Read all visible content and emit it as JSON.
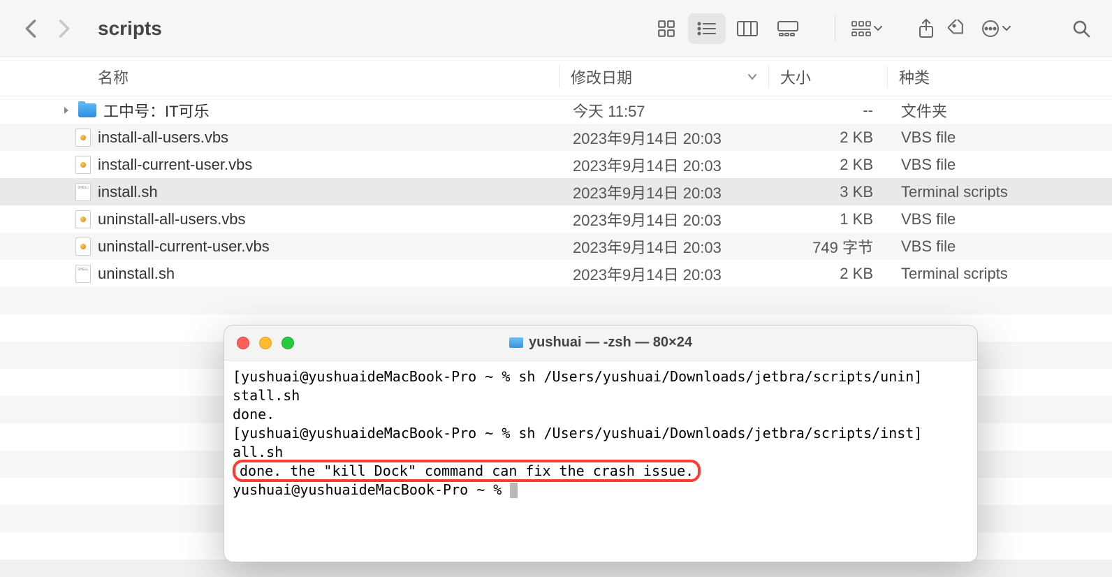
{
  "finder": {
    "title": "scripts",
    "columns": {
      "name": "名称",
      "date": "修改日期",
      "size": "大小",
      "kind": "种类"
    },
    "rows": [
      {
        "icon": "folder",
        "name": "工中号：IT可乐",
        "date": "今天 11:57",
        "size": "--",
        "kind": "文件夹",
        "hasDisclosure": true,
        "indent": false
      },
      {
        "icon": "vbs",
        "name": "install-all-users.vbs",
        "date": "2023年9月14日 20:03",
        "size": "2 KB",
        "kind": "VBS file",
        "indent": true
      },
      {
        "icon": "vbs",
        "name": "install-current-user.vbs",
        "date": "2023年9月14日 20:03",
        "size": "2 KB",
        "kind": "VBS file",
        "indent": true
      },
      {
        "icon": "sh",
        "name": "install.sh",
        "date": "2023年9月14日 20:03",
        "size": "3 KB",
        "kind": "Terminal scripts",
        "indent": true,
        "selected": true
      },
      {
        "icon": "vbs",
        "name": "uninstall-all-users.vbs",
        "date": "2023年9月14日 20:03",
        "size": "1 KB",
        "kind": "VBS file",
        "indent": true
      },
      {
        "icon": "vbs",
        "name": "uninstall-current-user.vbs",
        "date": "2023年9月14日 20:03",
        "size": "749 字节",
        "kind": "VBS file",
        "indent": true
      },
      {
        "icon": "sh",
        "name": "uninstall.sh",
        "date": "2023年9月14日 20:03",
        "size": "2 KB",
        "kind": "Terminal scripts",
        "indent": true
      }
    ]
  },
  "terminal": {
    "title": "yushuai — -zsh — 80×24",
    "lines": {
      "l1": "[yushuai@yushuaideMacBook-Pro ~ % sh /Users/yushuai/Downloads/jetbra/scripts/unin]",
      "l2": "stall.sh",
      "l3": "done.",
      "l4": "[yushuai@yushuaideMacBook-Pro ~ % sh /Users/yushuai/Downloads/jetbra/scripts/inst]",
      "l5": "all.sh",
      "l6": "done. the \"kill Dock\" command can fix the crash issue.",
      "l7": "yushuai@yushuaideMacBook-Pro ~ % "
    }
  }
}
